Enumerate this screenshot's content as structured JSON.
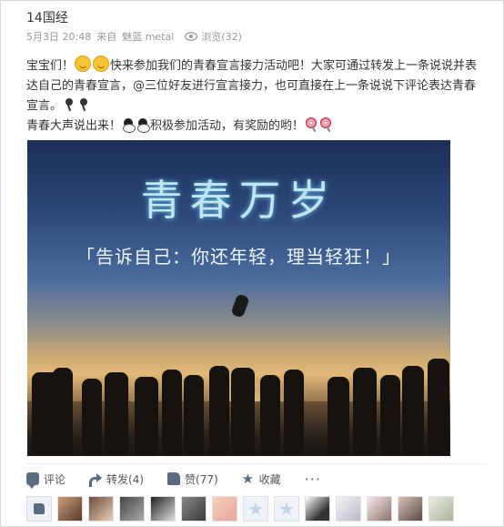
{
  "post": {
    "author": "14国经",
    "date": "5月3日 20:48",
    "source_prefix": "来自",
    "source": "魅蓝 metal",
    "views": "浏览(32)",
    "line1_a": "宝宝们！",
    "line1_b": "快来参加我们的青春宣言接力活动吧！大家可通过转发上一条说说并表达自己的青春宣言，@三位好友进行宣言接力，也可直接在上一条说说下评论表达青春宣言。",
    "line2_a": "青春大声说出来！",
    "line2_b": "积极参加活动，有奖励的哟！"
  },
  "photo": {
    "title": "青春万岁",
    "subtitle": "「告诉自己：你还年轻，理当轻狂！」"
  },
  "actions": {
    "comment": "评论",
    "forward": "转发(4)",
    "like": "赞(77)",
    "favorite": "收藏",
    "more": "···"
  },
  "icons": {
    "views": "eye-icon",
    "comment": "comment-icon",
    "forward": "forward-icon",
    "like": "thumbs-up-icon",
    "favorite": "star-icon"
  },
  "colors": {
    "icon": "#5a6a80",
    "meta_text": "#999999"
  }
}
